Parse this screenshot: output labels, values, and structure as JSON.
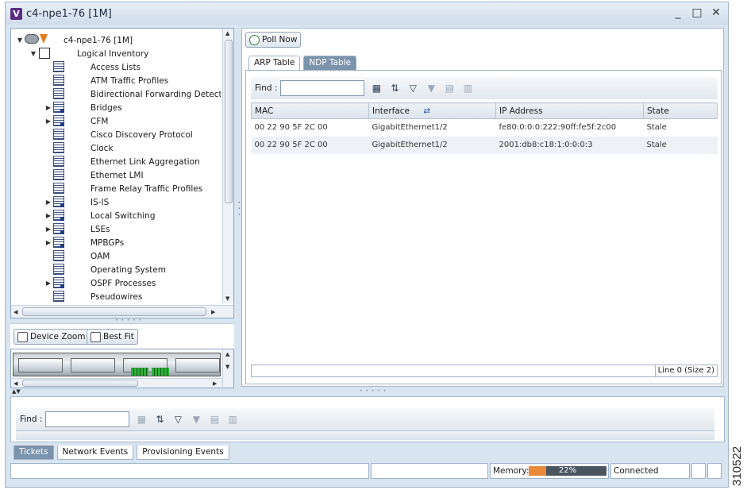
{
  "window": {
    "app_icon_letter": "V",
    "title": "c4-npe1-76 [1M]",
    "controls": {
      "minimize": "_",
      "maximize": "□",
      "close": "✕"
    }
  },
  "tree": {
    "root": {
      "label": "c4-npe1-76 [1M]",
      "icon": "router-icon"
    },
    "logical_inventory": {
      "label": "Logical Inventory",
      "icon": "inventory-icon"
    },
    "items": [
      {
        "label": "Access Lists",
        "expandable": false
      },
      {
        "label": "ATM Traffic Profiles",
        "expandable": false
      },
      {
        "label": "Bidirectional Forwarding Detection",
        "expandable": false
      },
      {
        "label": "Bridges",
        "expandable": true
      },
      {
        "label": "CFM",
        "expandable": true
      },
      {
        "label": "Cisco Discovery Protocol",
        "expandable": false
      },
      {
        "label": "Clock",
        "expandable": false
      },
      {
        "label": "Ethernet Link Aggregation",
        "expandable": false
      },
      {
        "label": "Ethernet LMI",
        "expandable": false
      },
      {
        "label": "Frame Relay Traffic Profiles",
        "expandable": false
      },
      {
        "label": "IS-IS",
        "expandable": true
      },
      {
        "label": "Local Switching",
        "expandable": true
      },
      {
        "label": "LSEs",
        "expandable": true
      },
      {
        "label": "MPBGPs",
        "expandable": true
      },
      {
        "label": "OAM",
        "expandable": false
      },
      {
        "label": "Operating System",
        "expandable": false
      },
      {
        "label": "OSPF Processes",
        "expandable": true
      },
      {
        "label": "Pseudowires",
        "expandable": false
      }
    ]
  },
  "zoom": {
    "device_zoom": "Device Zoom",
    "best_fit": "Best Fit"
  },
  "right": {
    "poll_now": "Poll Now",
    "tabs": [
      "ARP Table",
      "NDP Table"
    ],
    "active_tab": "NDP Table",
    "find_label": "Find :",
    "find_value": "",
    "columns": [
      "MAC",
      "Interface",
      "IP Address",
      "State"
    ],
    "rows": [
      [
        "00 22 90 5F 2C 00",
        "GigabitEthernet1/2",
        "fe80:0:0:0:222:90ff:fe5f:2c00",
        "Stale"
      ],
      [
        "00 22 90 5F 2C 00",
        "GigabitEthernet1/2",
        "2001:db8:c18:1:0:0:0:3",
        "Stale"
      ]
    ],
    "line_status": "Line 0 (Size 2)"
  },
  "bottom": {
    "find_label": "Find :",
    "find_value": "",
    "tabs": [
      "Tickets",
      "Network Events",
      "Provisioning Events"
    ],
    "active_tab": "Tickets"
  },
  "statusbar": {
    "memory_label": "Memory:",
    "memory_percent": 22,
    "memory_text": "22%",
    "connection": "Connected"
  },
  "side_id": "310522"
}
